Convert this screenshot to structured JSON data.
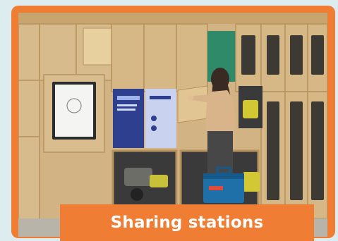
{
  "card": {
    "caption": "Sharing stations",
    "accent_color": "#ef7d34"
  },
  "photo": {
    "subject": "locker-wall-with-person",
    "icons": [
      "person-figure",
      "tool-case",
      "power-tool",
      "locker-doors",
      "screen-kiosk"
    ]
  }
}
